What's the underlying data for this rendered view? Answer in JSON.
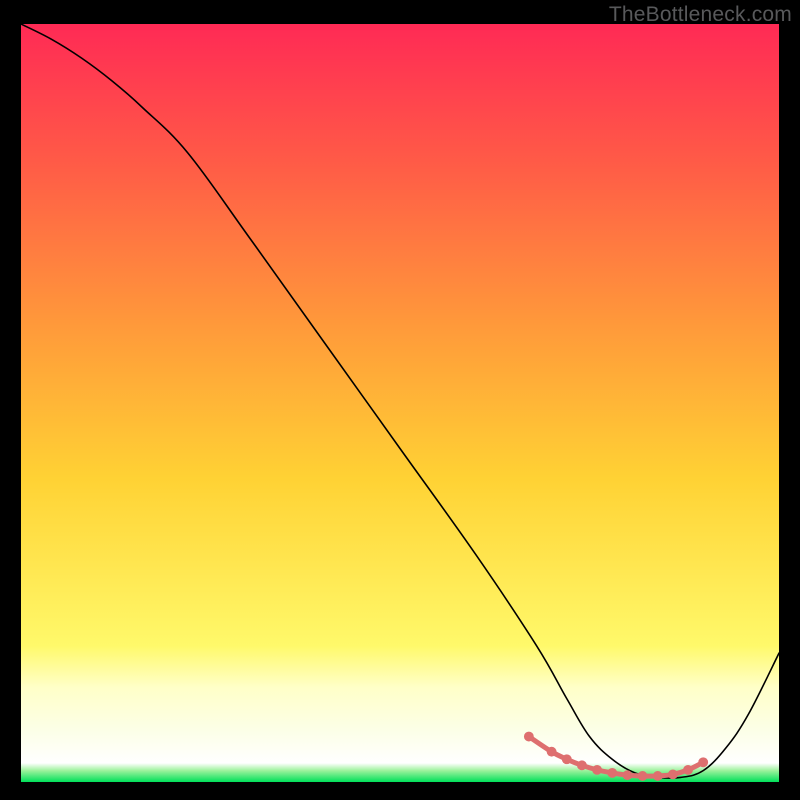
{
  "watermark": "TheBottleneck.com",
  "chart_data": {
    "type": "line",
    "title": "",
    "xlabel": "",
    "ylabel": "",
    "xlim": [
      0,
      100
    ],
    "ylim": [
      0,
      100
    ],
    "grid": false,
    "legend": false,
    "background_gradient": {
      "top": "#ff2a55",
      "mid_upper": "#ff8a3a",
      "mid": "#ffd234",
      "mid_lower": "#fff96a",
      "bottom": "#00e05a"
    },
    "series": [
      {
        "name": "curve",
        "color": "#000000",
        "x": [
          0,
          4,
          8,
          12,
          16,
          22,
          30,
          40,
          50,
          60,
          68,
          72,
          75,
          78,
          81,
          84,
          87,
          90,
          93,
          96,
          100
        ],
        "y": [
          100,
          98,
          95.5,
          92.5,
          89,
          83,
          72,
          58,
          44,
          30,
          18,
          11,
          6,
          3,
          1.2,
          0.6,
          0.6,
          1.5,
          4.5,
          9,
          17
        ]
      },
      {
        "name": "trough-markers",
        "color": "#e06a6a",
        "x": [
          67,
          70,
          72,
          74,
          76,
          78,
          80,
          82,
          84,
          86,
          88,
          90
        ],
        "y": [
          6.0,
          4.0,
          3.0,
          2.2,
          1.6,
          1.2,
          0.9,
          0.8,
          0.8,
          1.0,
          1.6,
          2.6
        ]
      }
    ],
    "green_band": {
      "y_from": 0,
      "y_to": 1.1
    },
    "pale_band": {
      "y_from": 1.1,
      "y_to": 10
    }
  }
}
